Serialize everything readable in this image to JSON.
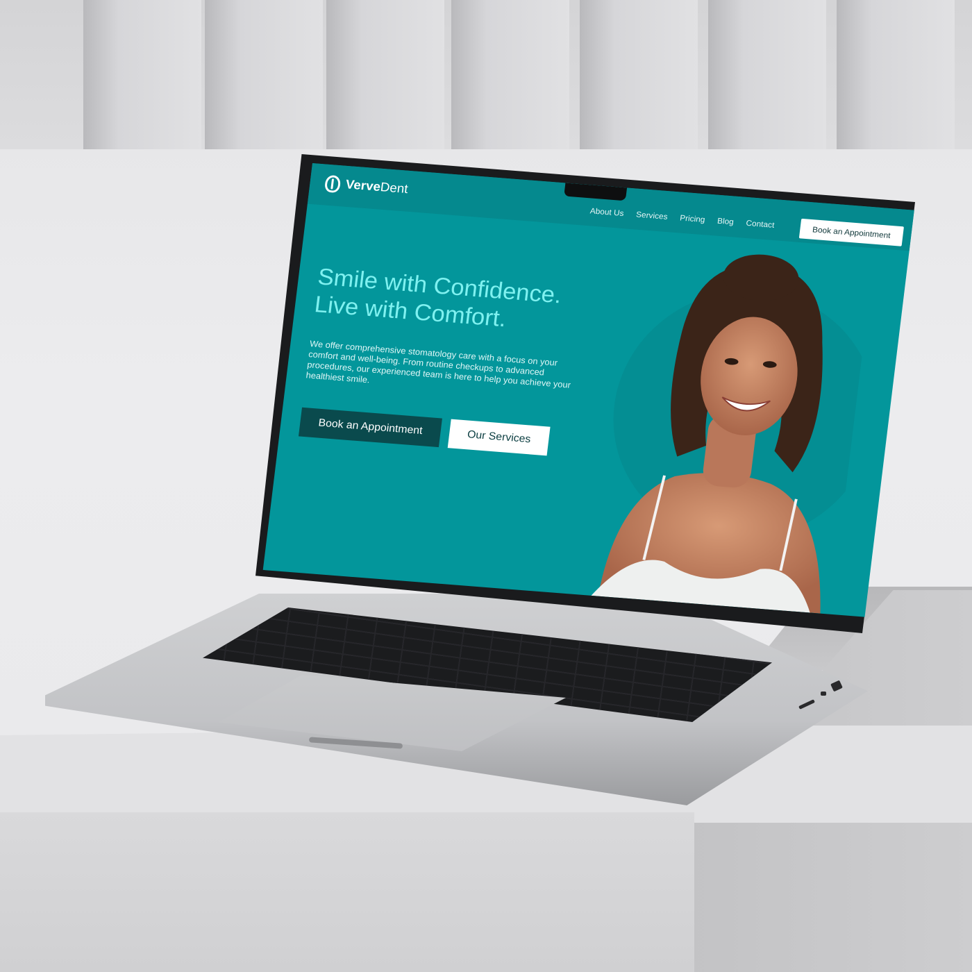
{
  "brand": {
    "name_bold": "Verve",
    "name_light": "Dent",
    "accent": "#03969b",
    "headline_color": "#7ff1f0",
    "dark_button": "#0a4a4d"
  },
  "nav": {
    "links": [
      "About Us",
      "Services",
      "Pricing",
      "Blog",
      "Contact"
    ],
    "cta": "Book an Appointment"
  },
  "hero": {
    "title_line1": "Smile with Confidence.",
    "title_line2": "Live with Comfort.",
    "body": "We offer comprehensive stomatology care with a focus on your comfort and well-being. From routine checkups to advanced procedures, our experienced team is here to help you achieve your healthiest smile.",
    "primary_button": "Book an Appointment",
    "secondary_button": "Our Services"
  }
}
